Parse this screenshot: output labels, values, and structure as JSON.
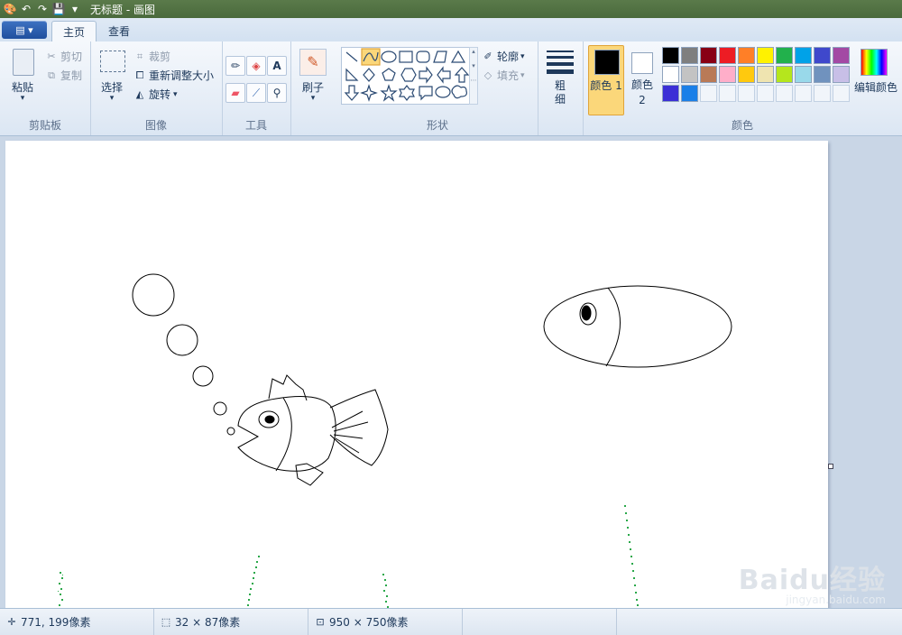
{
  "window": {
    "title": "无标题 - 画图",
    "app_menu_label": "▤ ▾"
  },
  "tabs": [
    {
      "label": "主页"
    },
    {
      "label": "查看"
    }
  ],
  "ribbon": {
    "clipboard": {
      "paste": "粘贴",
      "cut": "剪切",
      "copy": "复制",
      "group_label": "剪贴板"
    },
    "image": {
      "select": "选择",
      "crop": "裁剪",
      "resize": "重新调整大小",
      "rotate": "旋转",
      "group_label": "图像"
    },
    "tools": {
      "group_label": "工具"
    },
    "brushes": {
      "label": "刷子"
    },
    "shapes": {
      "outline": "轮廓",
      "fill": "填充",
      "group_label": "形状"
    },
    "size": {
      "label": "粗细"
    },
    "colors": {
      "color1": "颜色 1",
      "color2": "颜色 2",
      "edit_colors": "编辑颜色",
      "group_label": "颜色",
      "color1_value": "#000000",
      "color2_value": "#ffffff",
      "palette_row1": [
        "#000000",
        "#7f7f7f",
        "#880015",
        "#ed1c24",
        "#ff7f27",
        "#fff200",
        "#22b14c",
        "#00a2e8",
        "#3f48cc",
        "#a349a4"
      ],
      "palette_row2": [
        "#ffffff",
        "#c3c3c3",
        "#b97a57",
        "#ffaec9",
        "#ffc90e",
        "#efe4b0",
        "#b5e61d",
        "#99d9ea",
        "#7092be",
        "#c8bfe7"
      ],
      "palette_row3": [
        "#3b2fd6",
        "#1a7fe8",
        "",
        "",
        "",
        "",
        "",
        "",
        "",
        ""
      ]
    }
  },
  "statusbar": {
    "cursor_pos": "771, 199像素",
    "selection_size": "32 × 87像素",
    "canvas_size": "950 × 750像素"
  },
  "watermark": {
    "main": "Baidu经验",
    "sub": "jingyan.baidu.com"
  }
}
